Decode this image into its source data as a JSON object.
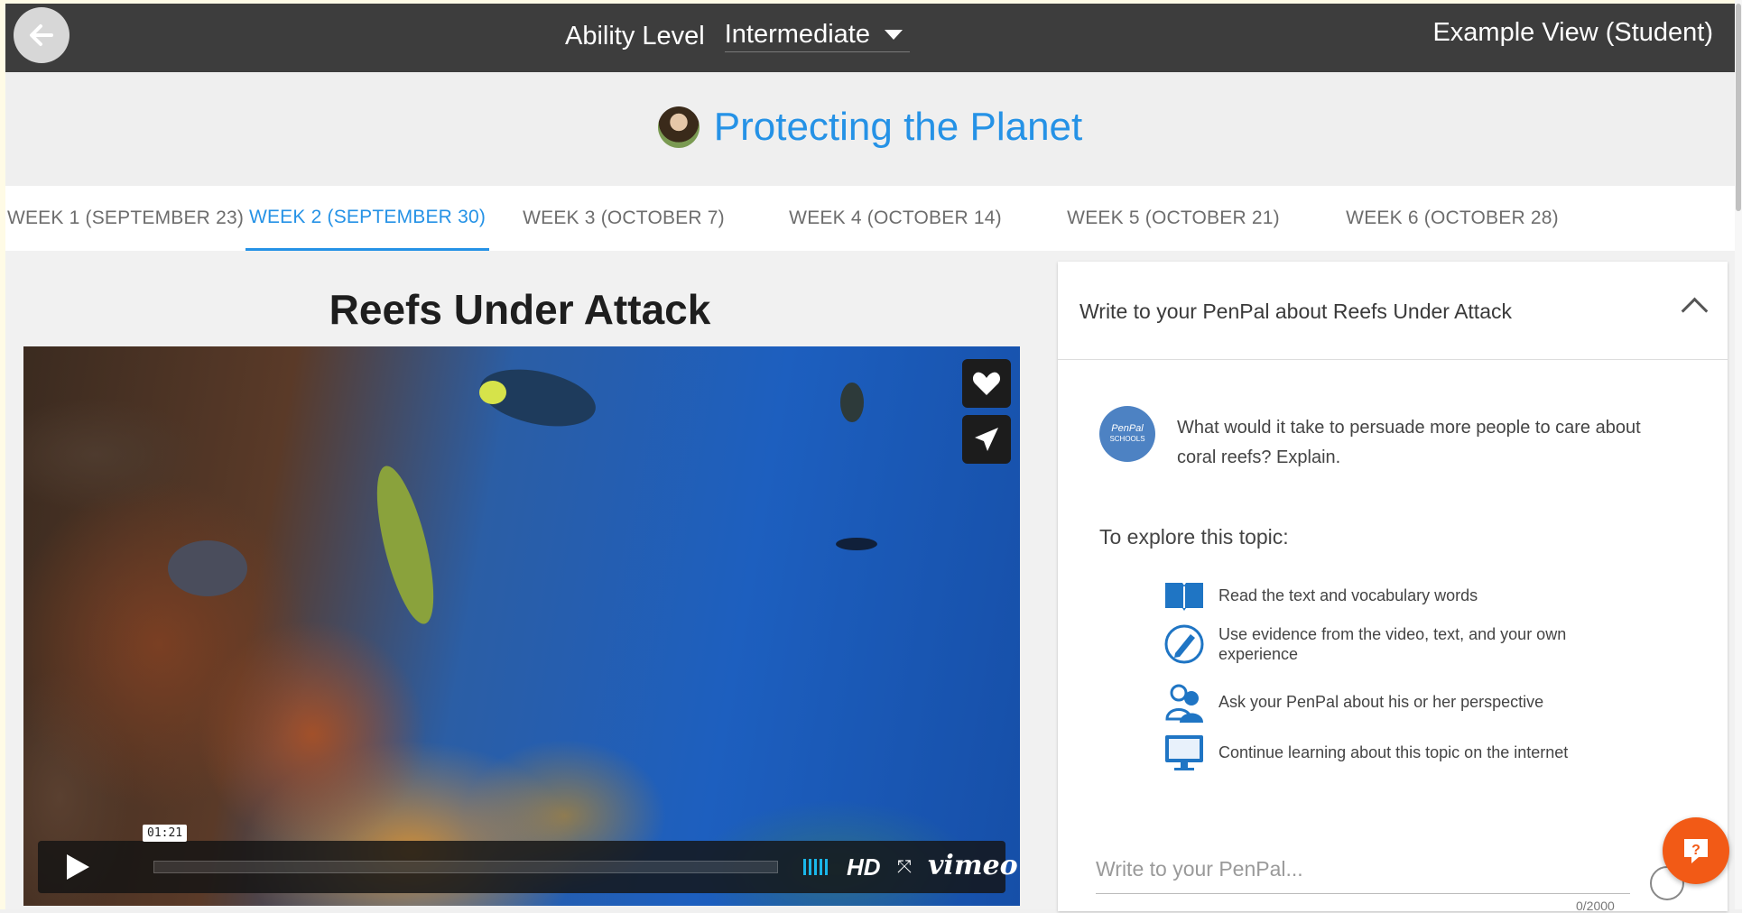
{
  "header": {
    "back_label": "back",
    "ability_label": "Ability Level",
    "ability_value": "Intermediate",
    "view_label": "Example View (Student)"
  },
  "course": {
    "title": "Protecting the Planet"
  },
  "tabs": [
    {
      "label": "WEEK 1 (SEPTEMBER 23)",
      "active": false
    },
    {
      "label": "WEEK 2 (SEPTEMBER 30)",
      "active": true
    },
    {
      "label": "WEEK 3 (OCTOBER 7)",
      "active": false
    },
    {
      "label": "WEEK 4 (OCTOBER 14)",
      "active": false
    },
    {
      "label": "WEEK 5 (OCTOBER 21)",
      "active": false
    },
    {
      "label": "WEEK 6 (OCTOBER 28)",
      "active": false
    }
  ],
  "lesson": {
    "title": "Reefs Under Attack",
    "video": {
      "time": "01:21",
      "hd_label": "HD",
      "brand": "vimeo",
      "progress": 0.03
    }
  },
  "penpal": {
    "header_title": "Write to your PenPal about Reefs Under Attack",
    "logo_line1": "PenPal",
    "logo_line2": "SCHOOLS",
    "prompt": "What would it take to persuade more people to care about coral reefs? Explain.",
    "explore_label": "To explore this topic:",
    "steps": [
      {
        "icon": "book-icon",
        "text": "Read the text and vocabulary words"
      },
      {
        "icon": "pencil-icon",
        "text": "Use evidence from the video, text, and your own experience"
      },
      {
        "icon": "people-icon",
        "text": "Ask your PenPal about his or her perspective"
      },
      {
        "icon": "monitor-icon",
        "text": "Continue learning about this topic on the internet"
      }
    ],
    "compose_placeholder": "Write to your PenPal...",
    "char_count": "0/2000"
  },
  "colors": {
    "accent": "#2592e6",
    "topbar": "#3d3d3d",
    "help": "#f25a16"
  }
}
